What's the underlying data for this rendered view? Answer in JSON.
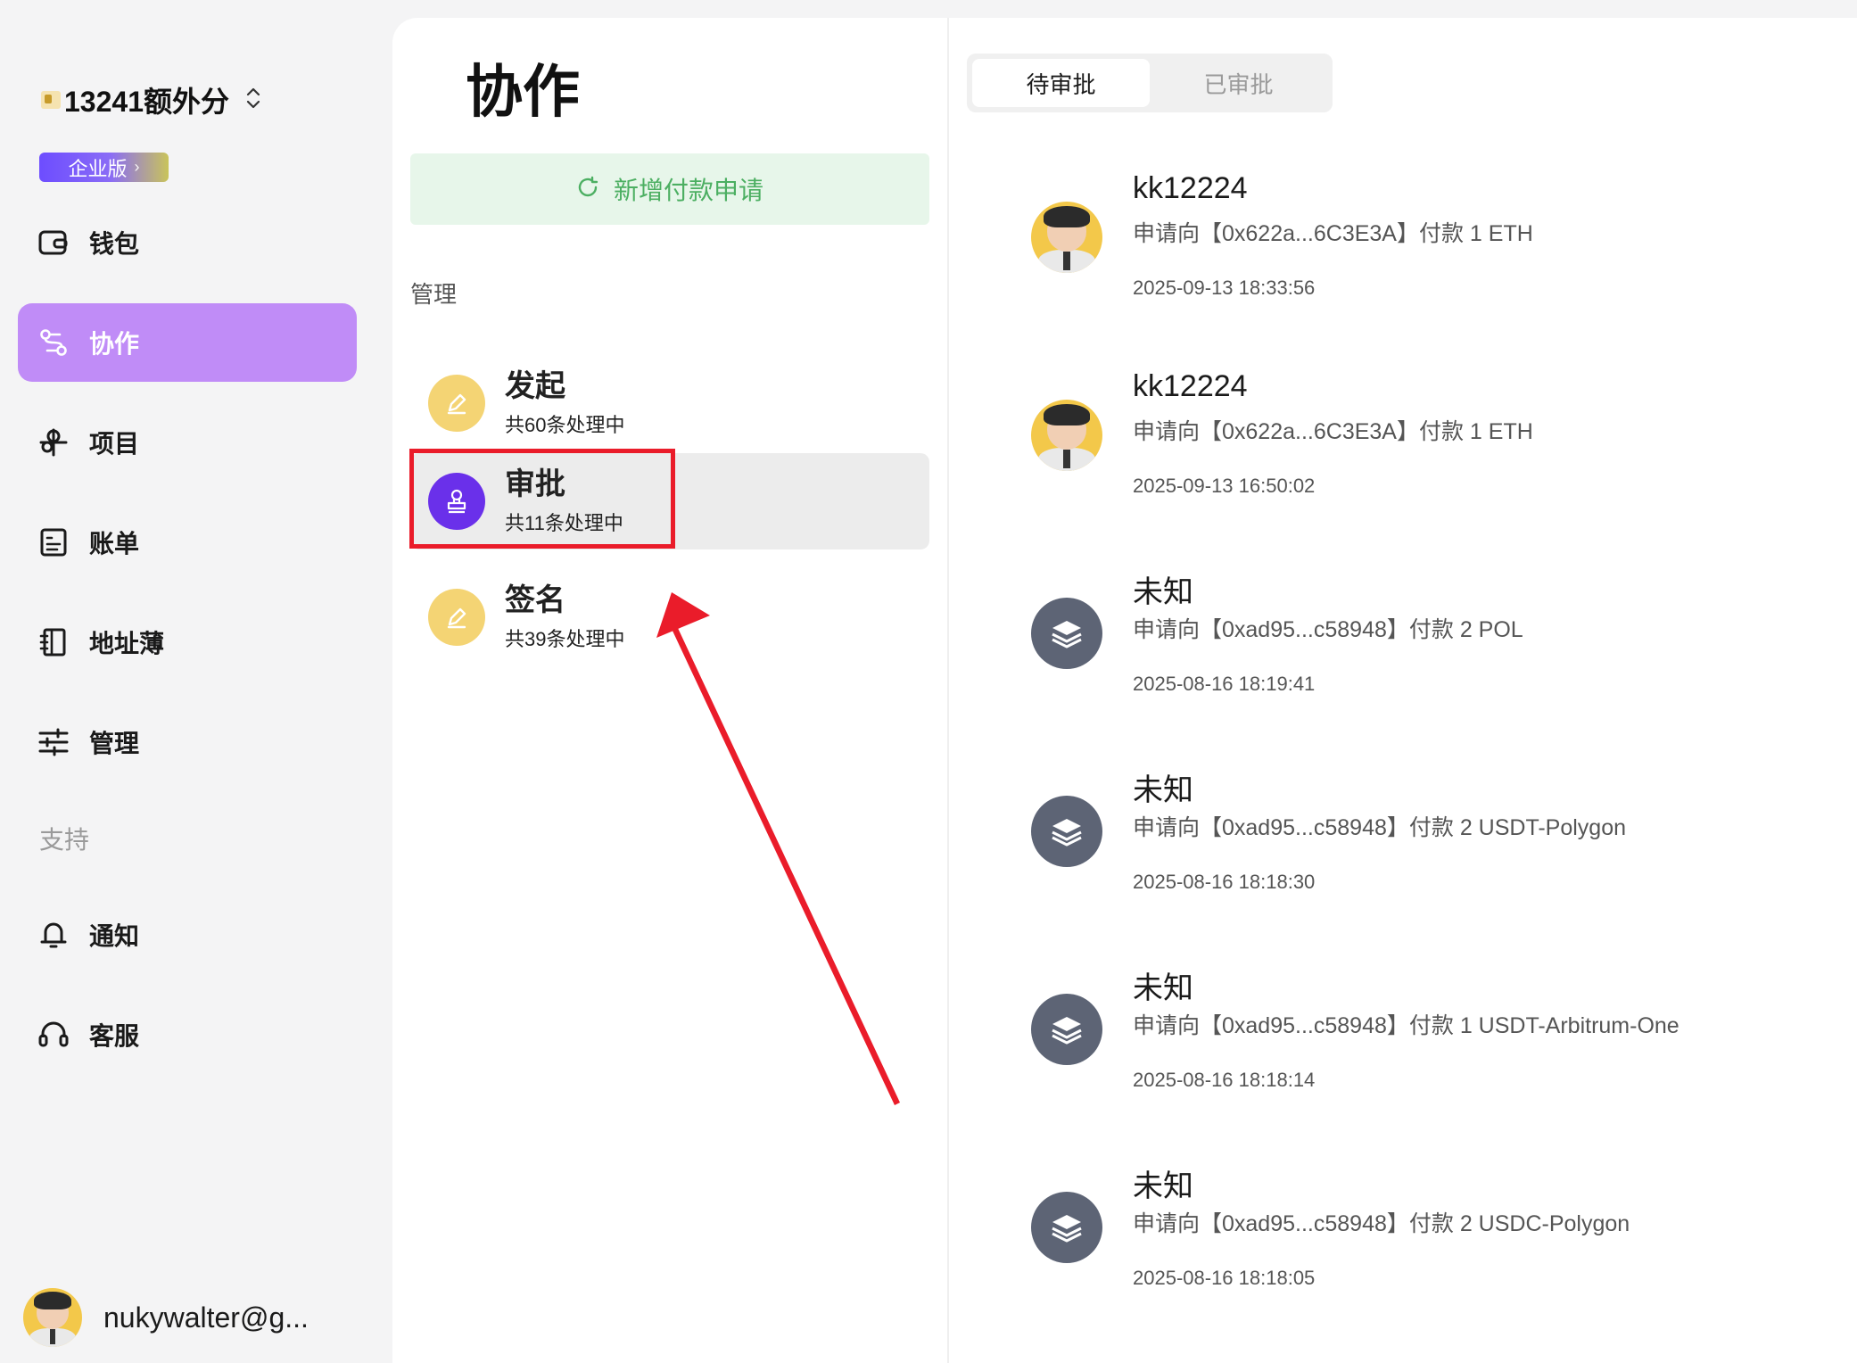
{
  "sidebar": {
    "org_name": "13241额外分",
    "plan_label": "企业版",
    "nav": [
      {
        "label": "钱包",
        "icon": "wallet-icon"
      },
      {
        "label": "协作",
        "icon": "collaboration-icon"
      },
      {
        "label": "项目",
        "icon": "project-icon"
      },
      {
        "label": "账单",
        "icon": "bill-icon"
      },
      {
        "label": "地址薄",
        "icon": "address-book-icon"
      },
      {
        "label": "管理",
        "icon": "sliders-icon"
      }
    ],
    "support_label": "支持",
    "support_nav": [
      {
        "label": "通知",
        "icon": "bell-icon"
      },
      {
        "label": "客服",
        "icon": "headset-icon"
      }
    ],
    "user_name": "nukywalter@g..."
  },
  "middle": {
    "title": "协作",
    "new_button_label": "新增付款申请",
    "manage_label": "管理",
    "items": [
      {
        "title": "发起",
        "subtitle": "共60条处理中"
      },
      {
        "title": "审批",
        "subtitle": "共11条处理中"
      },
      {
        "title": "签名",
        "subtitle": "共39条处理中"
      }
    ]
  },
  "right": {
    "tabs": [
      "待审批",
      "已审批"
    ],
    "approvals": [
      {
        "name": "kk12224",
        "desc": "申请向【0x622a...6C3E3A】付款 1 ETH",
        "time": "2025-09-13 18:33:56",
        "avatar": "user-avatar"
      },
      {
        "name": "kk12224",
        "desc": "申请向【0x622a...6C3E3A】付款 1 ETH",
        "time": "2025-09-13 16:50:02",
        "avatar": "user-avatar"
      },
      {
        "name": "未知",
        "desc": "申请向【0xad95...c58948】付款 2 POL",
        "time": "2025-08-16 18:19:41",
        "avatar": "layers-icon"
      },
      {
        "name": "未知",
        "desc": "申请向【0xad95...c58948】付款 2 USDT-Polygon",
        "time": "2025-08-16 18:18:30",
        "avatar": "layers-icon"
      },
      {
        "name": "未知",
        "desc": "申请向【0xad95...c58948】付款 1 USDT-Arbitrum-One",
        "time": "2025-08-16 18:18:14",
        "avatar": "layers-icon"
      },
      {
        "name": "未知",
        "desc": "申请向【0xad95...c58948】付款 2 USDC-Polygon",
        "time": "2025-08-16 18:18:05",
        "avatar": "layers-icon"
      }
    ]
  },
  "colors": {
    "active_nav": "#c08cf7",
    "new_button_bg": "#e7f6ea",
    "new_button_text": "#4caf62",
    "highlight": "#ea1c2a",
    "approve_icon": "#6a30ea"
  }
}
